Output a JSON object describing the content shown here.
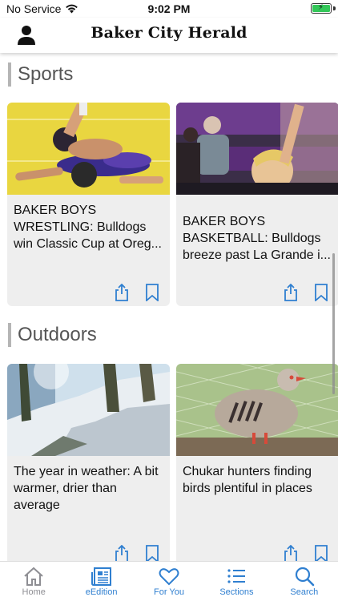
{
  "status_bar": {
    "carrier": "No Service",
    "time": "9:02 PM"
  },
  "header": {
    "brand": "Baker City Herald"
  },
  "sections": [
    {
      "title": "Sports",
      "articles": [
        {
          "title": "BAKER BOYS WRESTLING: Bulldogs win Classic Cup at Oreg..."
        },
        {
          "title": "BAKER BOYS BASKETBALL: Bulldogs breeze past La Grande i..."
        }
      ]
    },
    {
      "title": "Outdoors",
      "articles": [
        {
          "title": "The year in weather: A bit warmer, drier than average"
        },
        {
          "title": "Chukar hunters finding birds plentiful in places"
        }
      ]
    }
  ],
  "tab_bar": {
    "tabs": [
      {
        "label": "Home",
        "icon": "home-icon"
      },
      {
        "label": "eEdition",
        "icon": "newspaper-icon"
      },
      {
        "label": "For You",
        "icon": "heart-icon"
      },
      {
        "label": "Sections",
        "icon": "list-icon"
      },
      {
        "label": "Search",
        "icon": "search-icon"
      }
    ]
  },
  "colors": {
    "accent": "#2f7fd0",
    "inactive_tab": "#8e8e93",
    "card_bg": "#eeeeee",
    "battery": "#34c759"
  }
}
